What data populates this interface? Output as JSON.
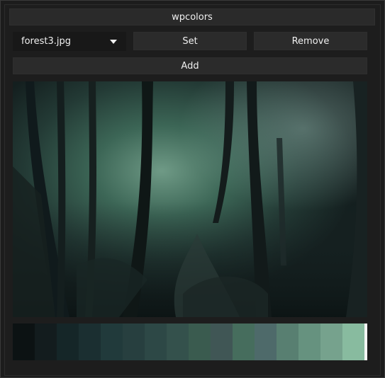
{
  "window": {
    "title": "wpcolors"
  },
  "controls": {
    "image_select": "forest3.jpg",
    "set_label": "Set",
    "remove_label": "Remove",
    "add_label": "Add"
  },
  "palette": [
    "#0c1213",
    "#131c1e",
    "#152628",
    "#1b2f31",
    "#213a3b",
    "#273f3f",
    "#2d4846",
    "#34514c",
    "#3a5b4f",
    "#405655",
    "#466d5d",
    "#4e6a6a",
    "#587f71",
    "#66927f",
    "#76a28d",
    "#88bb9f"
  ]
}
